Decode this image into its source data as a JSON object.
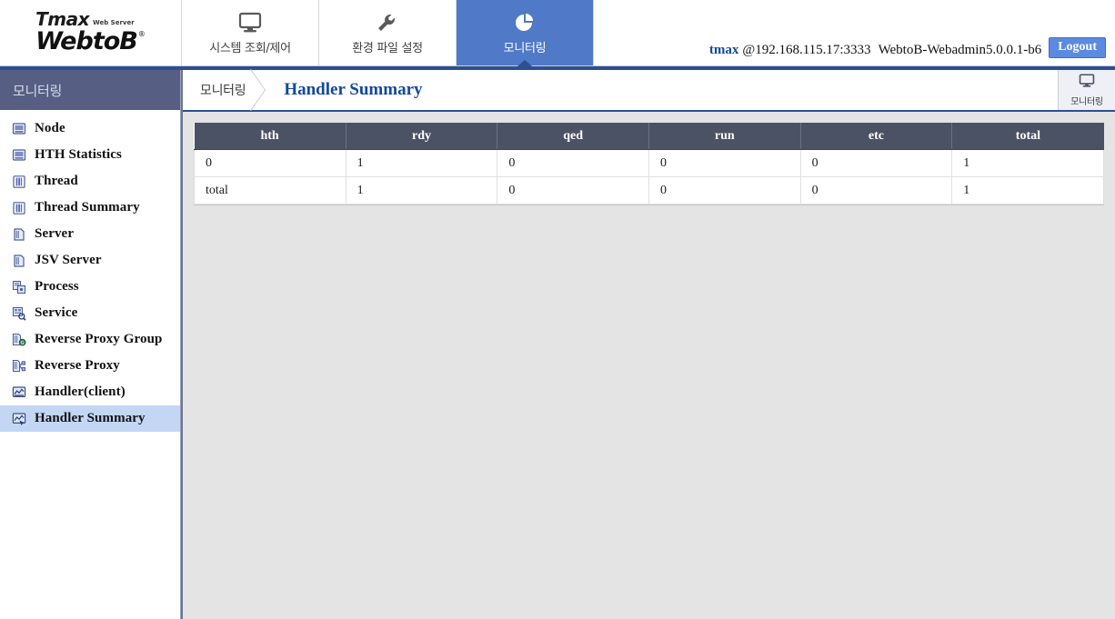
{
  "header": {
    "logo": {
      "brand": "Tmax",
      "tagline": "Web Server",
      "product": "WebtoB",
      "registered": "®"
    },
    "tabs": [
      {
        "label": "시스템 조회/제어",
        "icon": "monitor-icon",
        "active": false
      },
      {
        "label": "환경 파일 설정",
        "icon": "wrench-icon",
        "active": false
      },
      {
        "label": "모니터링",
        "icon": "pie-chart-icon",
        "active": true
      }
    ],
    "session": {
      "user": "tmax",
      "host": "@192.168.115.17:3333",
      "version": "WebtoB-Webadmin5.0.0.1-b6",
      "logout_label": "Logout"
    }
  },
  "sidebar": {
    "title": "모니터링",
    "items": [
      {
        "label": "Node",
        "icon": "node-icon",
        "selected": false
      },
      {
        "label": "HTH Statistics",
        "icon": "statistics-icon",
        "selected": false
      },
      {
        "label": "Thread",
        "icon": "thread-icon",
        "selected": false
      },
      {
        "label": "Thread Summary",
        "icon": "thread-summary-icon",
        "selected": false
      },
      {
        "label": "Server",
        "icon": "server-icon",
        "selected": false
      },
      {
        "label": "JSV Server",
        "icon": "jsv-server-icon",
        "selected": false
      },
      {
        "label": "Process",
        "icon": "process-icon",
        "selected": false
      },
      {
        "label": "Service",
        "icon": "service-icon",
        "selected": false
      },
      {
        "label": "Reverse Proxy Group",
        "icon": "reverse-proxy-group-icon",
        "selected": false
      },
      {
        "label": "Reverse Proxy",
        "icon": "reverse-proxy-icon",
        "selected": false
      },
      {
        "label": "Handler(client)",
        "icon": "handler-client-icon",
        "selected": false
      },
      {
        "label": "Handler Summary",
        "icon": "handler-summary-icon",
        "selected": true
      }
    ]
  },
  "breadcrumb": {
    "root": "모니터링",
    "current": "Handler Summary",
    "tool_label": "모니터링",
    "tool_icon": "monitor-icon"
  },
  "table": {
    "columns": [
      "hth",
      "rdy",
      "qed",
      "run",
      "etc",
      "total"
    ],
    "rows": [
      [
        "0",
        "1",
        "0",
        "0",
        "0",
        "1"
      ],
      [
        "total",
        "1",
        "0",
        "0",
        "0",
        "1"
      ]
    ]
  },
  "colors": {
    "accent_blue": "#5079c8",
    "rule_blue": "#2b4f92",
    "sidebar_head": "#565f83",
    "table_head": "#4b5263",
    "selected_row": "#c3d7f5",
    "content_bg": "#e4e4e4",
    "link_blue": "#12499b"
  }
}
